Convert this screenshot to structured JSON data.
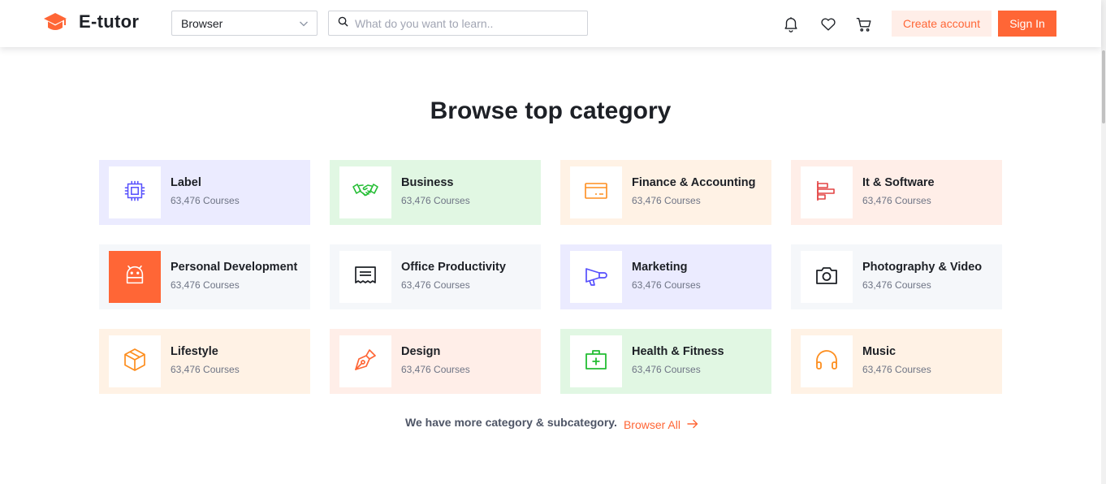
{
  "header": {
    "logo_text": "E-tutor",
    "browse_value": "Browser",
    "search_placeholder": "What do you want to learn..",
    "create_account_label": "Create account",
    "sign_in_label": "Sign In"
  },
  "colors": {
    "primary": "#ff6636",
    "primary_light": "#ffeee8"
  },
  "section": {
    "title": "Browse top category"
  },
  "categories": [
    {
      "name": "Label",
      "count": "63,476 Courses",
      "icon": "cpu-chip-icon",
      "bg": "#ebebff",
      "icon_color": "#564ffd"
    },
    {
      "name": "Business",
      "count": "63,476 Courses",
      "icon": "handshake-icon",
      "bg": "#e1f7e3",
      "icon_color": "#23bd33"
    },
    {
      "name": "Finance & Accounting",
      "count": "63,476 Courses",
      "icon": "credit-card-icon",
      "bg": "#fff2e5",
      "icon_color": "#fd8e1f"
    },
    {
      "name": "It & Software",
      "count": "63,476 Courses",
      "icon": "bar-chart-icon",
      "bg": "#ffeee8",
      "icon_color": "#e34444"
    },
    {
      "name": "Personal Development",
      "count": "63,476 Courses",
      "icon": "android-icon",
      "bg": "#f5f7fa",
      "icon_color": "#ff6636",
      "highlight": true
    },
    {
      "name": "Office Productivity",
      "count": "63,476 Courses",
      "icon": "receipt-icon",
      "bg": "#f5f7fa",
      "icon_color": "#1d2026"
    },
    {
      "name": "Marketing",
      "count": "63,476 Courses",
      "icon": "megaphone-icon",
      "bg": "#ebebff",
      "icon_color": "#564ffd"
    },
    {
      "name": "Photography & Video",
      "count": "63,476 Courses",
      "icon": "camera-icon",
      "bg": "#f5f7fa",
      "icon_color": "#1d2026"
    },
    {
      "name": "Lifestyle",
      "count": "63,476 Courses",
      "icon": "package-icon",
      "bg": "#fff2e5",
      "icon_color": "#fd8e1f"
    },
    {
      "name": "Design",
      "count": "63,476 Courses",
      "icon": "pen-nib-icon",
      "bg": "#ffeee8",
      "icon_color": "#ff6636"
    },
    {
      "name": "Health & Fitness",
      "count": "63,476 Courses",
      "icon": "first-aid-kit-icon",
      "bg": "#e1f7e3",
      "icon_color": "#23bd33"
    },
    {
      "name": "Music",
      "count": "63,476 Courses",
      "icon": "headphones-icon",
      "bg": "#fff2e5",
      "icon_color": "#fd8e1f"
    }
  ],
  "footer": {
    "more_text": "We have more category & subcategory.",
    "browse_all_label": "Browser All"
  }
}
